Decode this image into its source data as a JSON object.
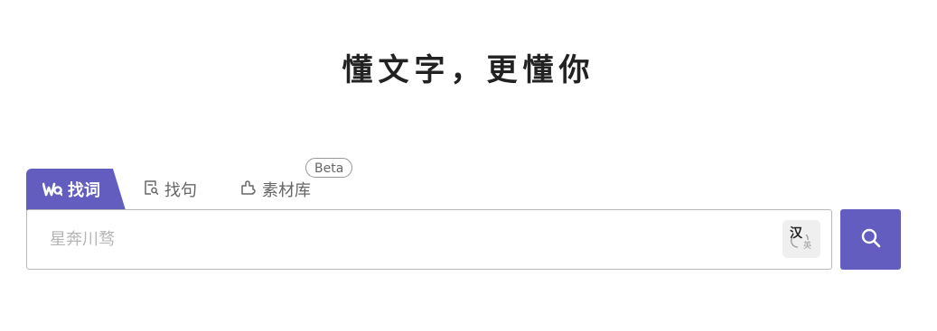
{
  "slogan": "懂文字，更懂你",
  "tabs": [
    {
      "label": "找词",
      "icon": "wq-logo-icon",
      "active": true
    },
    {
      "label": "找句",
      "icon": "document-search-icon",
      "active": false
    },
    {
      "label": "素材库",
      "icon": "puzzle-icon",
      "active": false,
      "badge": "Beta"
    }
  ],
  "search": {
    "placeholder": "星奔川骛",
    "value": ""
  },
  "lang_toggle": {
    "primary": "汉",
    "secondary": "英"
  },
  "search_button": {
    "icon": "search-icon"
  },
  "colors": {
    "accent": "#635dbf",
    "text": "#222222",
    "muted": "#666666",
    "placeholder": "#b5b5b5"
  }
}
